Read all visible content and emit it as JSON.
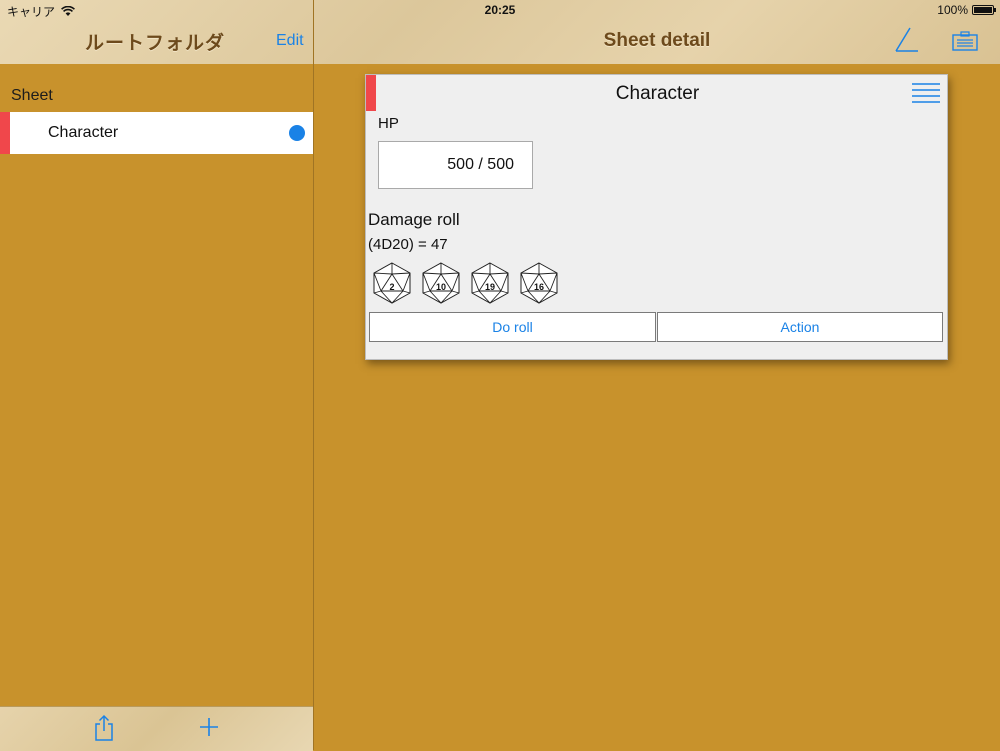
{
  "status_bar": {
    "carrier": "キャリア",
    "time": "20:25",
    "battery": "100%"
  },
  "master": {
    "title": "ルートフォルダ",
    "edit_label": "Edit",
    "section_header": "Sheet",
    "items": [
      {
        "label": "Character",
        "marker_color": "#f0474b",
        "dot_color": "#1a82e6"
      }
    ],
    "toolbar": {
      "share_icon": "share-icon",
      "add_icon": "plus-icon"
    }
  },
  "detail": {
    "title": "Sheet detail",
    "actions": {
      "edit_icon": "pen-icon",
      "board_icon": "board-icon"
    }
  },
  "card": {
    "title": "Character",
    "marker_color": "#f0474b",
    "hp_label": "HP",
    "hp_value": "500 / 500",
    "roll_label": "Damage roll",
    "roll_result": "(4D20) = 47",
    "dice": [
      "2",
      "10",
      "19",
      "16"
    ],
    "buttons": {
      "roll": "Do roll",
      "action": "Action"
    }
  },
  "colors": {
    "accent": "#1a82e6",
    "marker": "#f0474b",
    "background": "#c8922c",
    "bar": "#e6d3ab",
    "title_text": "#6d4a1c"
  }
}
